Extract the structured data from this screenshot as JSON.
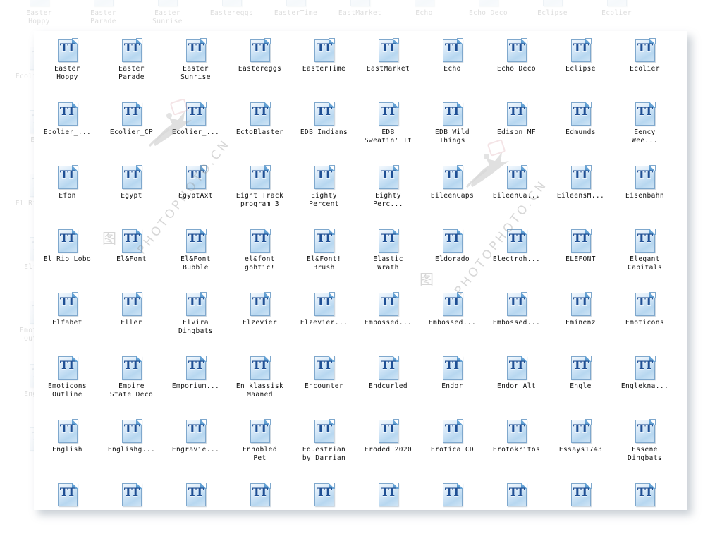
{
  "window": {
    "view_mode": "icons",
    "file_type": "TrueType font file",
    "icon_glyph": "TT",
    "columns": 10,
    "panel_background": "#ffffff",
    "page_background": "#ffffff",
    "icon_accent_color": "#1f4f94",
    "icon_body_color": "#cfe4f5",
    "label_color": "#111111"
  },
  "watermarks": [
    {
      "text": "PHOTOPHOTO.CN",
      "color": "#8b8b8b"
    },
    {
      "text": "PHOTOPHOTO.CN",
      "color": "#8b8b8b"
    }
  ],
  "files": [
    {
      "label": "Easter\nHoppy"
    },
    {
      "label": "Easter\nParade"
    },
    {
      "label": "Easter\nSunrise"
    },
    {
      "label": "Eastereggs"
    },
    {
      "label": "EasterTime"
    },
    {
      "label": "EastMarket"
    },
    {
      "label": "Echo"
    },
    {
      "label": "Echo Deco"
    },
    {
      "label": "Eclipse"
    },
    {
      "label": "Ecolier"
    },
    {
      "label": "Ecolier_..."
    },
    {
      "label": "Ecolier_CP"
    },
    {
      "label": "Ecolier_..."
    },
    {
      "label": "EctoBlaster"
    },
    {
      "label": "EDB Indians"
    },
    {
      "label": "EDB\nSweatin' It"
    },
    {
      "label": "EDB Wild\nThings"
    },
    {
      "label": "Edison MF"
    },
    {
      "label": "Edmunds"
    },
    {
      "label": "Eency\nWee..."
    },
    {
      "label": "Efon"
    },
    {
      "label": "Egypt"
    },
    {
      "label": "EgyptAxt"
    },
    {
      "label": "Eight Track\nprogram 3"
    },
    {
      "label": "Eighty\nPercent"
    },
    {
      "label": "Eighty\nPerc..."
    },
    {
      "label": "EileenCaps"
    },
    {
      "label": "EileenCa..."
    },
    {
      "label": "EileensM..."
    },
    {
      "label": "Eisenbahn"
    },
    {
      "label": "El Rio Lobo"
    },
    {
      "label": "El&Font"
    },
    {
      "label": "El&Font\nBubble"
    },
    {
      "label": "el&font\ngohtic!"
    },
    {
      "label": "El&Font!\nBrush"
    },
    {
      "label": "Elastic\nWrath"
    },
    {
      "label": "Eldorado"
    },
    {
      "label": "Electroh..."
    },
    {
      "label": "ELEFONT"
    },
    {
      "label": "Elegant\nCapitals"
    },
    {
      "label": "Elfabet"
    },
    {
      "label": "Eller"
    },
    {
      "label": "Elvira\nDingbats"
    },
    {
      "label": "Elzevier"
    },
    {
      "label": "Elzevier..."
    },
    {
      "label": "Embossed..."
    },
    {
      "label": "Embossed..."
    },
    {
      "label": "Embossed..."
    },
    {
      "label": "Eminenz"
    },
    {
      "label": "Emoticons"
    },
    {
      "label": "Emoticons\nOutline"
    },
    {
      "label": "Empire\nState Deco"
    },
    {
      "label": "Emporium..."
    },
    {
      "label": "En klassisk\nMaaned"
    },
    {
      "label": "Encounter"
    },
    {
      "label": "Endcurled"
    },
    {
      "label": "Endor"
    },
    {
      "label": "Endor Alt"
    },
    {
      "label": "Engle"
    },
    {
      "label": "Englekna..."
    },
    {
      "label": "English"
    },
    {
      "label": "Englishg..."
    },
    {
      "label": "Engravie..."
    },
    {
      "label": "Ennobled\nPet"
    },
    {
      "label": "Equestrian\nby Darrian"
    },
    {
      "label": "Eroded 2020"
    },
    {
      "label": "Erotica CD"
    },
    {
      "label": "Erotokritos"
    },
    {
      "label": "Essays1743"
    },
    {
      "label": "Essene\nDingbats"
    },
    {
      "label": ""
    },
    {
      "label": ""
    },
    {
      "label": ""
    },
    {
      "label": ""
    },
    {
      "label": ""
    },
    {
      "label": ""
    },
    {
      "label": ""
    },
    {
      "label": ""
    },
    {
      "label": ""
    },
    {
      "label": ""
    }
  ]
}
